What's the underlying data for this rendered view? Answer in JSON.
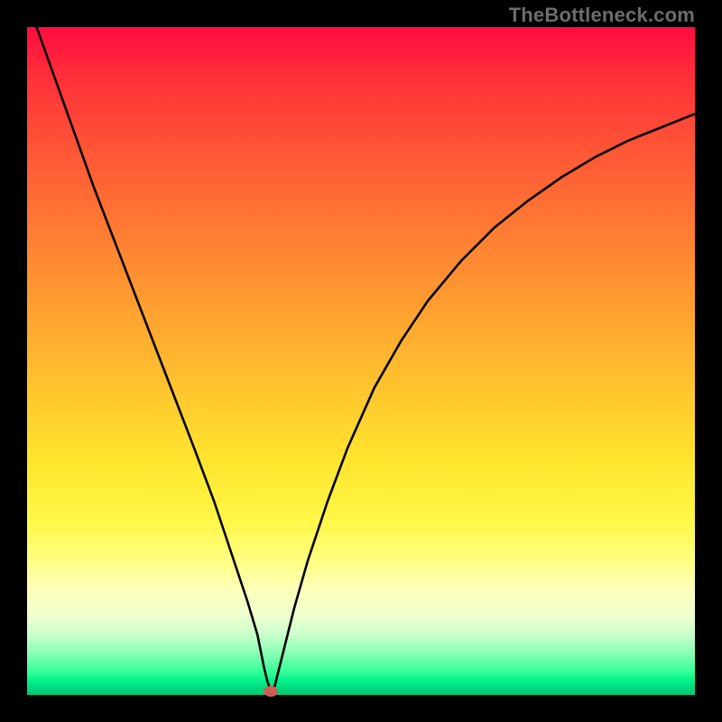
{
  "watermark": "TheBottleneck.com",
  "chart_data": {
    "type": "line",
    "title": "",
    "xlabel": "",
    "ylabel": "",
    "xlim": [
      0,
      100
    ],
    "ylim": [
      0,
      100
    ],
    "grid": false,
    "series": [
      {
        "name": "bottleneck-curve",
        "x": [
          0,
          5,
          10,
          15,
          20,
          25,
          28,
          31,
          33,
          34.5,
          35.5,
          36,
          36.5,
          37,
          37.5,
          38.5,
          40,
          42,
          45,
          48,
          52,
          56,
          60,
          65,
          70,
          75,
          80,
          85,
          90,
          95,
          100
        ],
        "values": [
          104,
          90,
          76,
          63,
          50,
          37,
          29,
          20,
          14,
          9,
          4,
          2,
          0.5,
          1,
          3,
          7,
          13,
          20,
          29,
          37,
          46,
          53,
          59,
          65,
          70,
          74,
          77.5,
          80.5,
          83,
          85,
          87
        ]
      }
    ],
    "marker": {
      "name": "optimal-point",
      "x": 36.5,
      "y": 0.5,
      "color": "#cc5f55"
    }
  }
}
